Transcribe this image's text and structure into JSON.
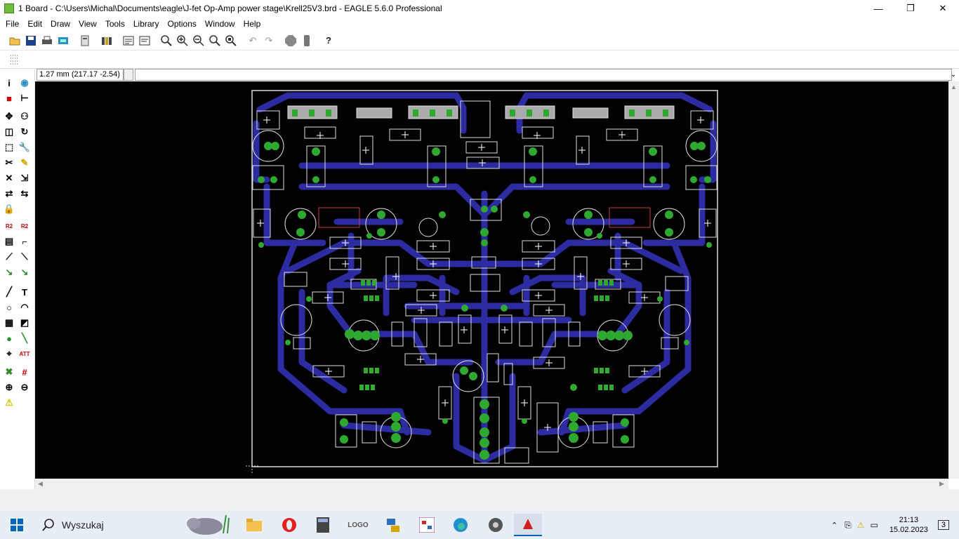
{
  "window": {
    "title": "1 Board - C:\\Users\\Michal\\Documents\\eagle\\J-fet Op-Amp power stage\\Krell25V3.brd - EAGLE 5.6.0 Professional",
    "minimize": "—",
    "restore": "❐",
    "close": "✕"
  },
  "menu": [
    "File",
    "Edit",
    "Draw",
    "View",
    "Tools",
    "Library",
    "Options",
    "Window",
    "Help"
  ],
  "toolbar": {
    "icons": [
      "open-icon",
      "save-icon",
      "print-icon",
      "cam-icon",
      "board-icon",
      "library-icon",
      "script-icon",
      "ulp-icon",
      "zoom-fit-icon",
      "zoom-in-icon",
      "zoom-out-icon",
      "zoom-redraw-icon",
      "zoom-select-icon",
      "undo-icon",
      "redo-icon",
      "stop-icon",
      "go-icon",
      "help-icon"
    ]
  },
  "command": {
    "coordinates": "1.27 mm (217.17 -2.54)",
    "input_value": ""
  },
  "taskbar": {
    "search_placeholder": "Wyszukaj",
    "time": "21:13",
    "date": "15.02.2023",
    "notifications": "3"
  }
}
